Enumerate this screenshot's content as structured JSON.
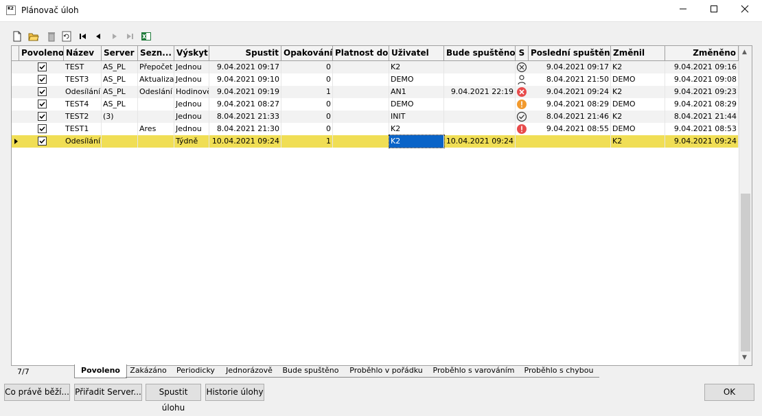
{
  "window": {
    "title": "Plánovač úloh",
    "icon_label": "K2"
  },
  "toolbar": {
    "icons": [
      "new-file-icon",
      "open-folder-icon",
      "delete-icon",
      "refresh-icon",
      "first-record-icon",
      "prev-record-icon",
      "next-record-icon",
      "last-record-icon",
      "excel-export-icon"
    ]
  },
  "columns": [
    "Povoleno",
    "Název",
    "Server",
    "Sezn...",
    "Výskyt",
    "Spustit",
    "Opakování",
    "Platnost do",
    "Uživatel",
    "Bude spuštěno",
    "S",
    "Poslední spuštění",
    "Změnil",
    "Změněno"
  ],
  "rows": [
    {
      "enabled": true,
      "name": "TEST",
      "server": "AS_PL",
      "list": "Přepočet s",
      "occurrence": "Jednou",
      "start": "9.04.2021 09:17",
      "repeat": "0",
      "valid_until": "",
      "user": "K2",
      "will_run": "",
      "status": "cancelled-icon",
      "last_run": "9.04.2021 09:17",
      "changed_by": "K2",
      "changed": "9.04.2021 09:16"
    },
    {
      "enabled": true,
      "name": "TEST3",
      "server": "AS_PL",
      "list": "Aktualizace",
      "occurrence": "Jednou",
      "start": "9.04.2021 09:10",
      "repeat": "0",
      "valid_until": "",
      "user": "DEMO",
      "will_run": "",
      "status": "user-icon",
      "last_run": "8.04.2021 21:50",
      "changed_by": "DEMO",
      "changed": "9.04.2021 09:08"
    },
    {
      "enabled": true,
      "name": "Odesílání s",
      "server": "AS_PL",
      "list": "Odeslání e",
      "occurrence": "Hodinově",
      "start": "9.04.2021 09:19",
      "repeat": "1",
      "valid_until": "",
      "user": "AN1",
      "will_run": "9.04.2021 22:19",
      "status": "error-x-icon",
      "last_run": "9.04.2021 09:24",
      "changed_by": "K2",
      "changed": "9.04.2021 09:23"
    },
    {
      "enabled": true,
      "name": "TEST4",
      "server": "AS_PL",
      "list": "",
      "occurrence": "Jednou",
      "start": "9.04.2021 08:27",
      "repeat": "0",
      "valid_until": "",
      "user": "DEMO",
      "will_run": "",
      "status": "warning-icon",
      "last_run": "9.04.2021 08:29",
      "changed_by": "DEMO",
      "changed": "9.04.2021 08:29"
    },
    {
      "enabled": true,
      "name": "TEST2",
      "server": "(3)",
      "list": "",
      "occurrence": "Jednou",
      "start": "8.04.2021 21:33",
      "repeat": "0",
      "valid_until": "",
      "user": "INIT",
      "will_run": "",
      "status": "ok-check-icon",
      "last_run": "8.04.2021 21:46",
      "changed_by": "K2",
      "changed": "8.04.2021 21:44"
    },
    {
      "enabled": true,
      "name": "TEST1",
      "server": "",
      "list": "Ares",
      "occurrence": "Jednou",
      "start": "8.04.2021 21:30",
      "repeat": "0",
      "valid_until": "",
      "user": "K2",
      "will_run": "",
      "status": "error-exclamation-icon",
      "last_run": "9.04.2021 08:55",
      "changed_by": "DEMO",
      "changed": "9.04.2021 08:53"
    },
    {
      "enabled": true,
      "name": "Odesílání s",
      "server": "",
      "list": "",
      "occurrence": "Týdně",
      "start": "10.04.2021 09:24",
      "repeat": "1",
      "valid_until": "",
      "user": "K2",
      "will_run": "10.04.2021 09:24",
      "status": "",
      "last_run": "",
      "changed_by": "K2",
      "changed": "9.04.2021 09:24",
      "selected": true
    }
  ],
  "status": {
    "count": "7/7"
  },
  "tabs": [
    "Povoleno",
    "Zakázáno",
    "Periodicky",
    "Jednorázově",
    "Bude spuštěno",
    "Proběhlo v pořádku",
    "Proběhlo s varováním",
    "Proběhlo s chybou"
  ],
  "buttons": {
    "running": "Co právě běží...",
    "assign_server": "Přiřadit Server...",
    "run_task": "Spustit úlohu",
    "history": "Historie úlohy",
    "ok": "OK"
  },
  "colors": {
    "selected_row": "#f0de55",
    "user_cell_selected": "#0a64c8",
    "error": "#e84b4b",
    "warning": "#f29a2e"
  }
}
